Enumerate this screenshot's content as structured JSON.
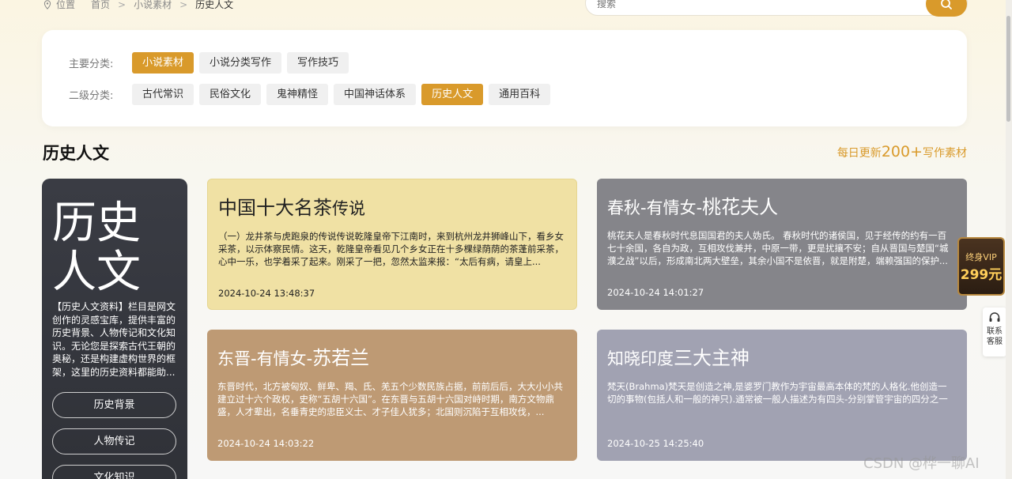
{
  "breadcrumb": {
    "location_label": "位置",
    "items": [
      "首页",
      "小说素材",
      "历史人文"
    ]
  },
  "search": {
    "placeholder": "搜索"
  },
  "filters": {
    "primary_label": "主要分类:",
    "primary": [
      "小说素材",
      "小说分类写作",
      "写作技巧"
    ],
    "primary_active": "小说素材",
    "secondary_label": "二级分类:",
    "secondary": [
      "古代常识",
      "民俗文化",
      "鬼神精怪",
      "中国神话体系",
      "历史人文",
      "通用百科"
    ],
    "secondary_active": "历史人文"
  },
  "section": {
    "title": "历史人文",
    "more_prefix": "每日更新",
    "more_number": "200+",
    "more_suffix": "写作素材"
  },
  "side_card": {
    "big_title": "历史人文",
    "description": "【历史人文资料】栏目是网文创作的灵感宝库，提供丰富的历史背景、人物传记和文化知识。无论您是探索古代王朝的奥秘，还是构建虚构世界的框架，这里的历史资料都能助...",
    "buttons": [
      "历史背景",
      "人物传记",
      "文化知识"
    ]
  },
  "articles": [
    {
      "title_pre": "中国十大名茶",
      "title_main": "传说",
      "body": "（一）龙井茶与虎跑泉的传说传说乾隆皇帝下江南时，来到杭州龙井狮峰山下，看乡女采茶，以示体察民情。这天，乾隆皇帝看见几个乡女正在十多棵绿荫荫的茶蓬前采茶，心中一乐，也学着采了起来。刚采了一把，忽然太监来报：“太后有病，请皇上...",
      "time": "2024-10-24 13:48:37",
      "color": "#f0e1a4"
    },
    {
      "title_pre": "春秋-有情女-",
      "title_main": "桃花夫人",
      "body": "桃花夫人是春秋时代息国国君的夫人妫氏。 春秋时代的诸侯国，见于经传的约有一百七十余国，各自为政，互相攻伐兼并，中原一带，更是扰攘不安；自从晋国与楚国“城濮之战”以后，形成南北两大壁垒，其余小国不是依晋，就是附楚，端赖强国的保护...",
      "time": "2024-10-24 14:01:27",
      "color": "#85858a"
    },
    {
      "title_pre": "东晋-有情女-",
      "title_main": "苏若兰",
      "body": "东晋时代，北方被匈奴、鲜卑、羯、氐、羌五个少数民族占据，前前后后，大大小小共建立过十六个政权，史称“五胡十六国”。在东晋与五胡十六国对峙时期，南方文物鼎盛，人才辈出，名垂青史的忠臣义士、才子佳人犹多；北国则沉陷于互相攻伐，...",
      "time": "2024-10-24 14:03:22",
      "color": "#be9a74"
    },
    {
      "title_pre": "知晓印度",
      "title_main": "三大主神",
      "body": "梵天(Brahma)梵天是创造之神,是婆罗门教作为宇宙最高本体的梵的人格化.他创造一切的事物(包括人和一般的神只).通常被一般人描述为有四头-分别掌管宇宙的四分之一",
      "time": "2024-10-25 14:25:40",
      "color": "#a1a2b2"
    }
  ],
  "vip_badge": {
    "line1": "终身VIP",
    "line2": "299元"
  },
  "service": {
    "line1": "联系",
    "line2": "客服",
    "icon": "headset-icon"
  },
  "watermark": "CSDN @桦一聊AI",
  "icons": {
    "breadcrumb": "location-pin-icon",
    "search": "search-icon"
  },
  "colors": {
    "accent": "#d99a2b",
    "side_card": "#34363d"
  }
}
